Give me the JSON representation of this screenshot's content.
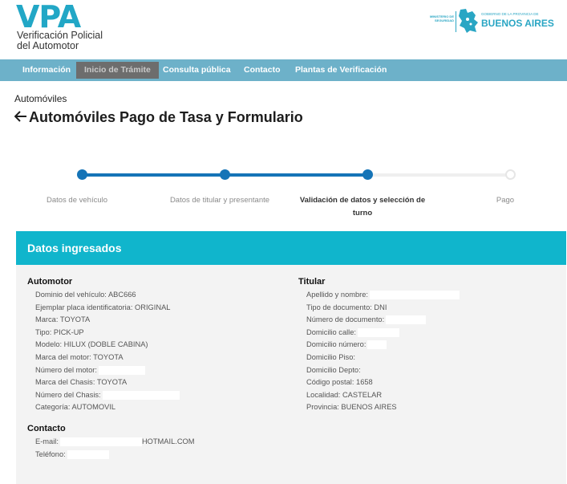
{
  "header": {
    "logo_title": "VPA",
    "logo_subtitle_1": "Verificación Policial",
    "logo_subtitle_2": "del Automotor",
    "gov_ministry_1": "MINISTERIO DE",
    "gov_ministry_2": "SEGURIDAD",
    "gov_province": "GOBIERNO DE LA PROVINCIA DE",
    "gov_name": "BUENOS AIRES",
    "brand_color": "#22a7c6"
  },
  "nav": {
    "items": [
      {
        "label": "Información",
        "active": false
      },
      {
        "label": "Inicio de Trámite",
        "active": true
      },
      {
        "label": "Consulta pública",
        "active": false
      },
      {
        "label": "Contacto",
        "active": false
      },
      {
        "label": "Plantas de Verificación",
        "active": false
      }
    ],
    "bar_color": "#6db1c9"
  },
  "breadcrumb": "Automóviles",
  "page_title": "Automóviles Pago de Tasa y Formulario",
  "stepper": {
    "steps": [
      {
        "label": "Datos de vehículo",
        "state": "done"
      },
      {
        "label": "Datos de titular y presentante",
        "state": "done"
      },
      {
        "label_1": "Validación de datos y selección de",
        "label_2": "turno",
        "state": "current"
      },
      {
        "label": "Pago",
        "state": "todo"
      }
    ],
    "accent": "#1574b7"
  },
  "panel": {
    "title": "Datos ingresados",
    "header_color": "#10b5cc",
    "automotor": {
      "title": "Automotor",
      "rows": [
        "Dominio del vehículo: ABC666",
        "Ejemplar placa identificatoria: ORIGINAL",
        "Marca: TOYOTA",
        "Tipo: PICK-UP",
        "Modelo: HILUX (DOBLE CABINA)",
        "Marca del motor: TOYOTA",
        "Número del motor:",
        "Marca del Chasis: TOYOTA",
        "Número del Chasis:",
        "Categoría: AUTOMOVIL"
      ]
    },
    "contacto": {
      "title": "Contacto",
      "email_label": "E-mail:",
      "email_suffix": "HOTMAIL.COM",
      "phone_label": "Teléfono:"
    },
    "titular": {
      "title": "Titular",
      "rows": [
        "Apellido y nombre:",
        "Tipo de documento: DNI",
        "Número de documento:",
        "Domicilio calle:",
        "Domicilio número:",
        "Domicilio Piso:",
        "Domicilio Depto:",
        "Código postal: 1658",
        "Localidad: CASTELAR",
        "Provincia: BUENOS AIRES"
      ]
    }
  }
}
